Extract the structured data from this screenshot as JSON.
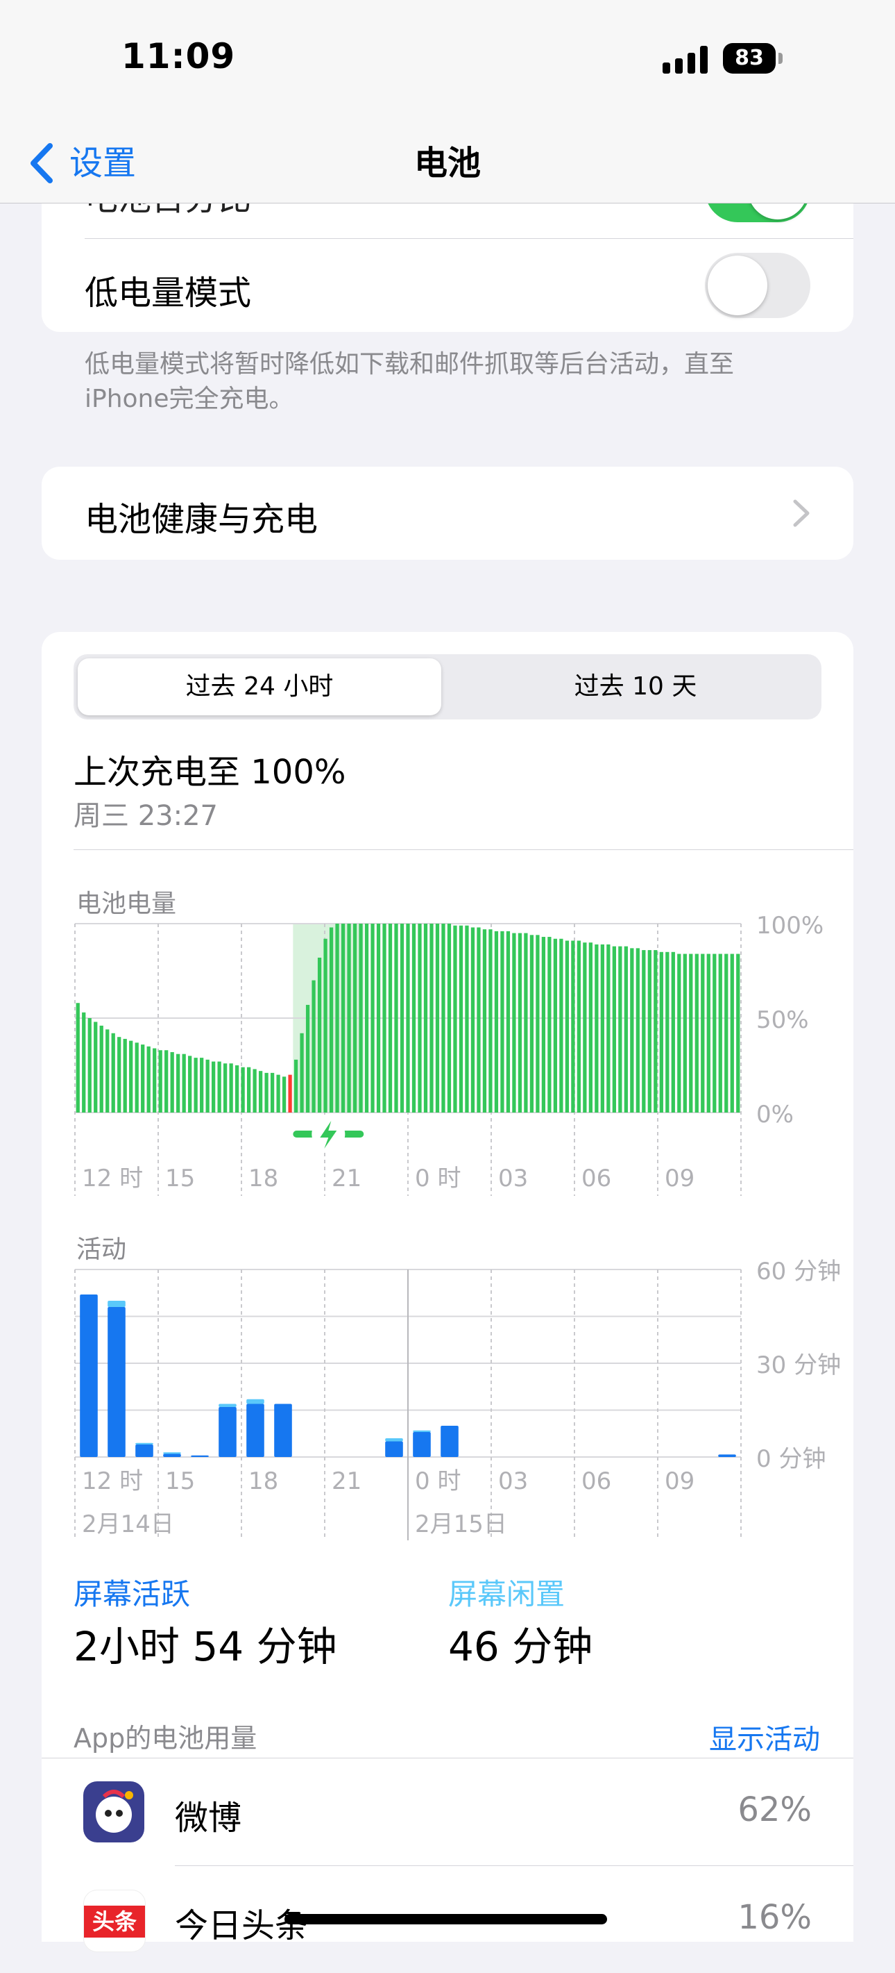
{
  "status_bar": {
    "time": "11:09",
    "battery_level": "83"
  },
  "nav": {
    "back_label": "设置",
    "title": "电池"
  },
  "partial_row": {
    "label": "电池百分比",
    "enabled": true
  },
  "low_power": {
    "label": "低电量模式",
    "enabled": false,
    "footnote": "低电量模式将暂时降低如下载和邮件抓取等后台活动，直至iPhone完全充电。"
  },
  "health": {
    "label": "电池健康与充电"
  },
  "segment": {
    "options": [
      "过去 24 小时",
      "过去 10 天"
    ],
    "selected": 0
  },
  "last_charge": {
    "title": "上次充电至 100%",
    "time": "周三 23:27"
  },
  "battery_chart": {
    "title": "电池电量",
    "y_labels": [
      "100%",
      "50%",
      "0%"
    ],
    "x_labels": [
      "12 时",
      "15",
      "18",
      "21",
      "0 时",
      "03",
      "06",
      "09"
    ]
  },
  "activity_chart": {
    "title": "活动",
    "y_labels": [
      "60 分钟",
      "30 分钟",
      "0 分钟"
    ],
    "x_labels": [
      "12 时",
      "15",
      "18",
      "21",
      "0 时",
      "03",
      "06",
      "09"
    ],
    "date_labels": [
      "2月14日",
      "2月15日"
    ]
  },
  "chart_data": [
    {
      "type": "bar",
      "title": "电池电量",
      "ylabel": "",
      "xlabel": "",
      "ylim": [
        0,
        100
      ],
      "x_ticks": [
        "12 时",
        "15",
        "18",
        "21",
        "0 时",
        "03",
        "06",
        "09"
      ],
      "charging_window": {
        "start_index": 37,
        "end_index": 49
      },
      "low_index": 36,
      "values": [
        58,
        53,
        50,
        48,
        46,
        44,
        42,
        40,
        39,
        38,
        37,
        36,
        35,
        34,
        33,
        33,
        32,
        31,
        31,
        30,
        29,
        29,
        28,
        27,
        27,
        26,
        26,
        25,
        24,
        24,
        23,
        22,
        21,
        21,
        20,
        19,
        20,
        28,
        42,
        57,
        70,
        82,
        92,
        98,
        100,
        100,
        100,
        100,
        100,
        100,
        100,
        100,
        100,
        100,
        100,
        100,
        100,
        100,
        100,
        100,
        100,
        100,
        100,
        100,
        99,
        99,
        99,
        98,
        98,
        97,
        97,
        96,
        96,
        96,
        95,
        95,
        95,
        94,
        94,
        93,
        93,
        92,
        92,
        91,
        91,
        91,
        90,
        90,
        89,
        89,
        89,
        88,
        88,
        88,
        87,
        87,
        86,
        86,
        86,
        85,
        85,
        85,
        84,
        84,
        84,
        84,
        84,
        84,
        84,
        84,
        84,
        84,
        84
      ]
    },
    {
      "type": "bar",
      "title": "活动",
      "ylabel": "",
      "xlabel": "",
      "ylim": [
        0,
        60
      ],
      "categories": [
        "12",
        "13",
        "14",
        "15",
        "16",
        "17",
        "18",
        "19",
        "20",
        "21",
        "22",
        "23",
        "0",
        "1",
        "2",
        "3",
        "4",
        "5",
        "6",
        "7",
        "8",
        "9",
        "10",
        "11"
      ],
      "series": [
        {
          "name": "屏幕活跃",
          "values": [
            52,
            48,
            4,
            1,
            0.5,
            16,
            17,
            17,
            0,
            0,
            0,
            5,
            8,
            10,
            0,
            0,
            0,
            0,
            0,
            0,
            0,
            0,
            0,
            0.8
          ]
        },
        {
          "name": "屏幕闲置",
          "values": [
            0,
            2,
            0.5,
            0.5,
            0,
            1,
            1.5,
            0,
            0,
            0,
            0,
            1,
            0.5,
            0,
            0,
            0,
            0,
            0,
            0,
            0,
            0,
            0,
            0,
            0
          ]
        }
      ]
    }
  ],
  "screen_stats": {
    "active_label": "屏幕活跃",
    "active_value": "2小时 54 分钟",
    "idle_label": "屏幕闲置",
    "idle_value": "46 分钟"
  },
  "app_usage": {
    "header": "App的电池用量",
    "toggle_link": "显示活动",
    "apps": [
      {
        "name": "微博",
        "percent": "62%"
      },
      {
        "name": "今日头条",
        "percent": "16%",
        "icon_text": "头条"
      }
    ]
  }
}
